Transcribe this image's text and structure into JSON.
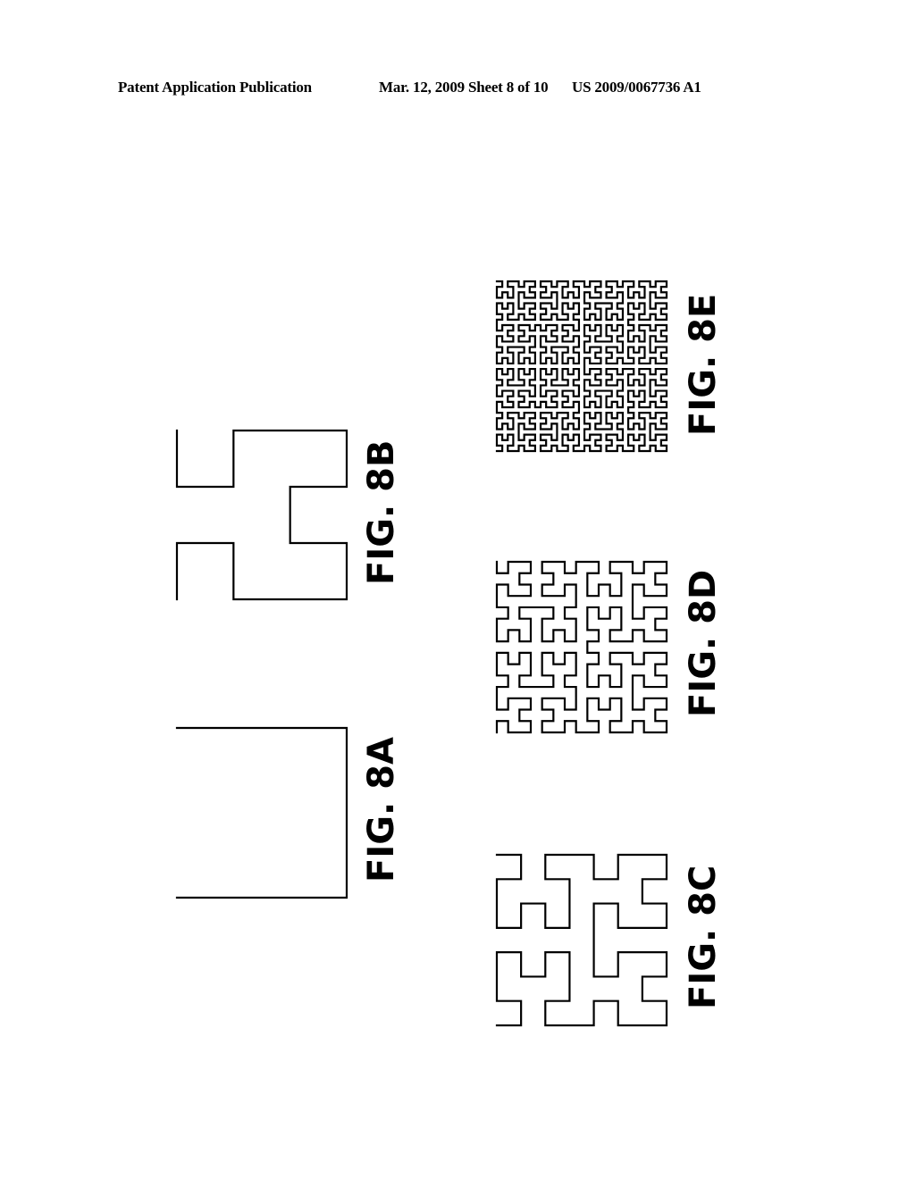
{
  "header": {
    "publication": "Patent Application Publication",
    "date_sheet": "Mar. 12, 2009  Sheet 8 of 10",
    "number": "US 2009/0067736 A1"
  },
  "figures": [
    {
      "id": "8A",
      "label": "FIG. 8A",
      "description": "Hilbert curve",
      "order": 1
    },
    {
      "id": "8B",
      "label": "FIG. 8B",
      "description": "Hilbert curve",
      "order": 2
    },
    {
      "id": "8C",
      "label": "FIG. 8C",
      "description": "Hilbert curve",
      "order": 3
    },
    {
      "id": "8D",
      "label": "FIG. 8D",
      "description": "Hilbert curve",
      "order": 4
    },
    {
      "id": "8E",
      "label": "FIG. 8E",
      "description": "Hilbert curve",
      "order": 5
    }
  ]
}
